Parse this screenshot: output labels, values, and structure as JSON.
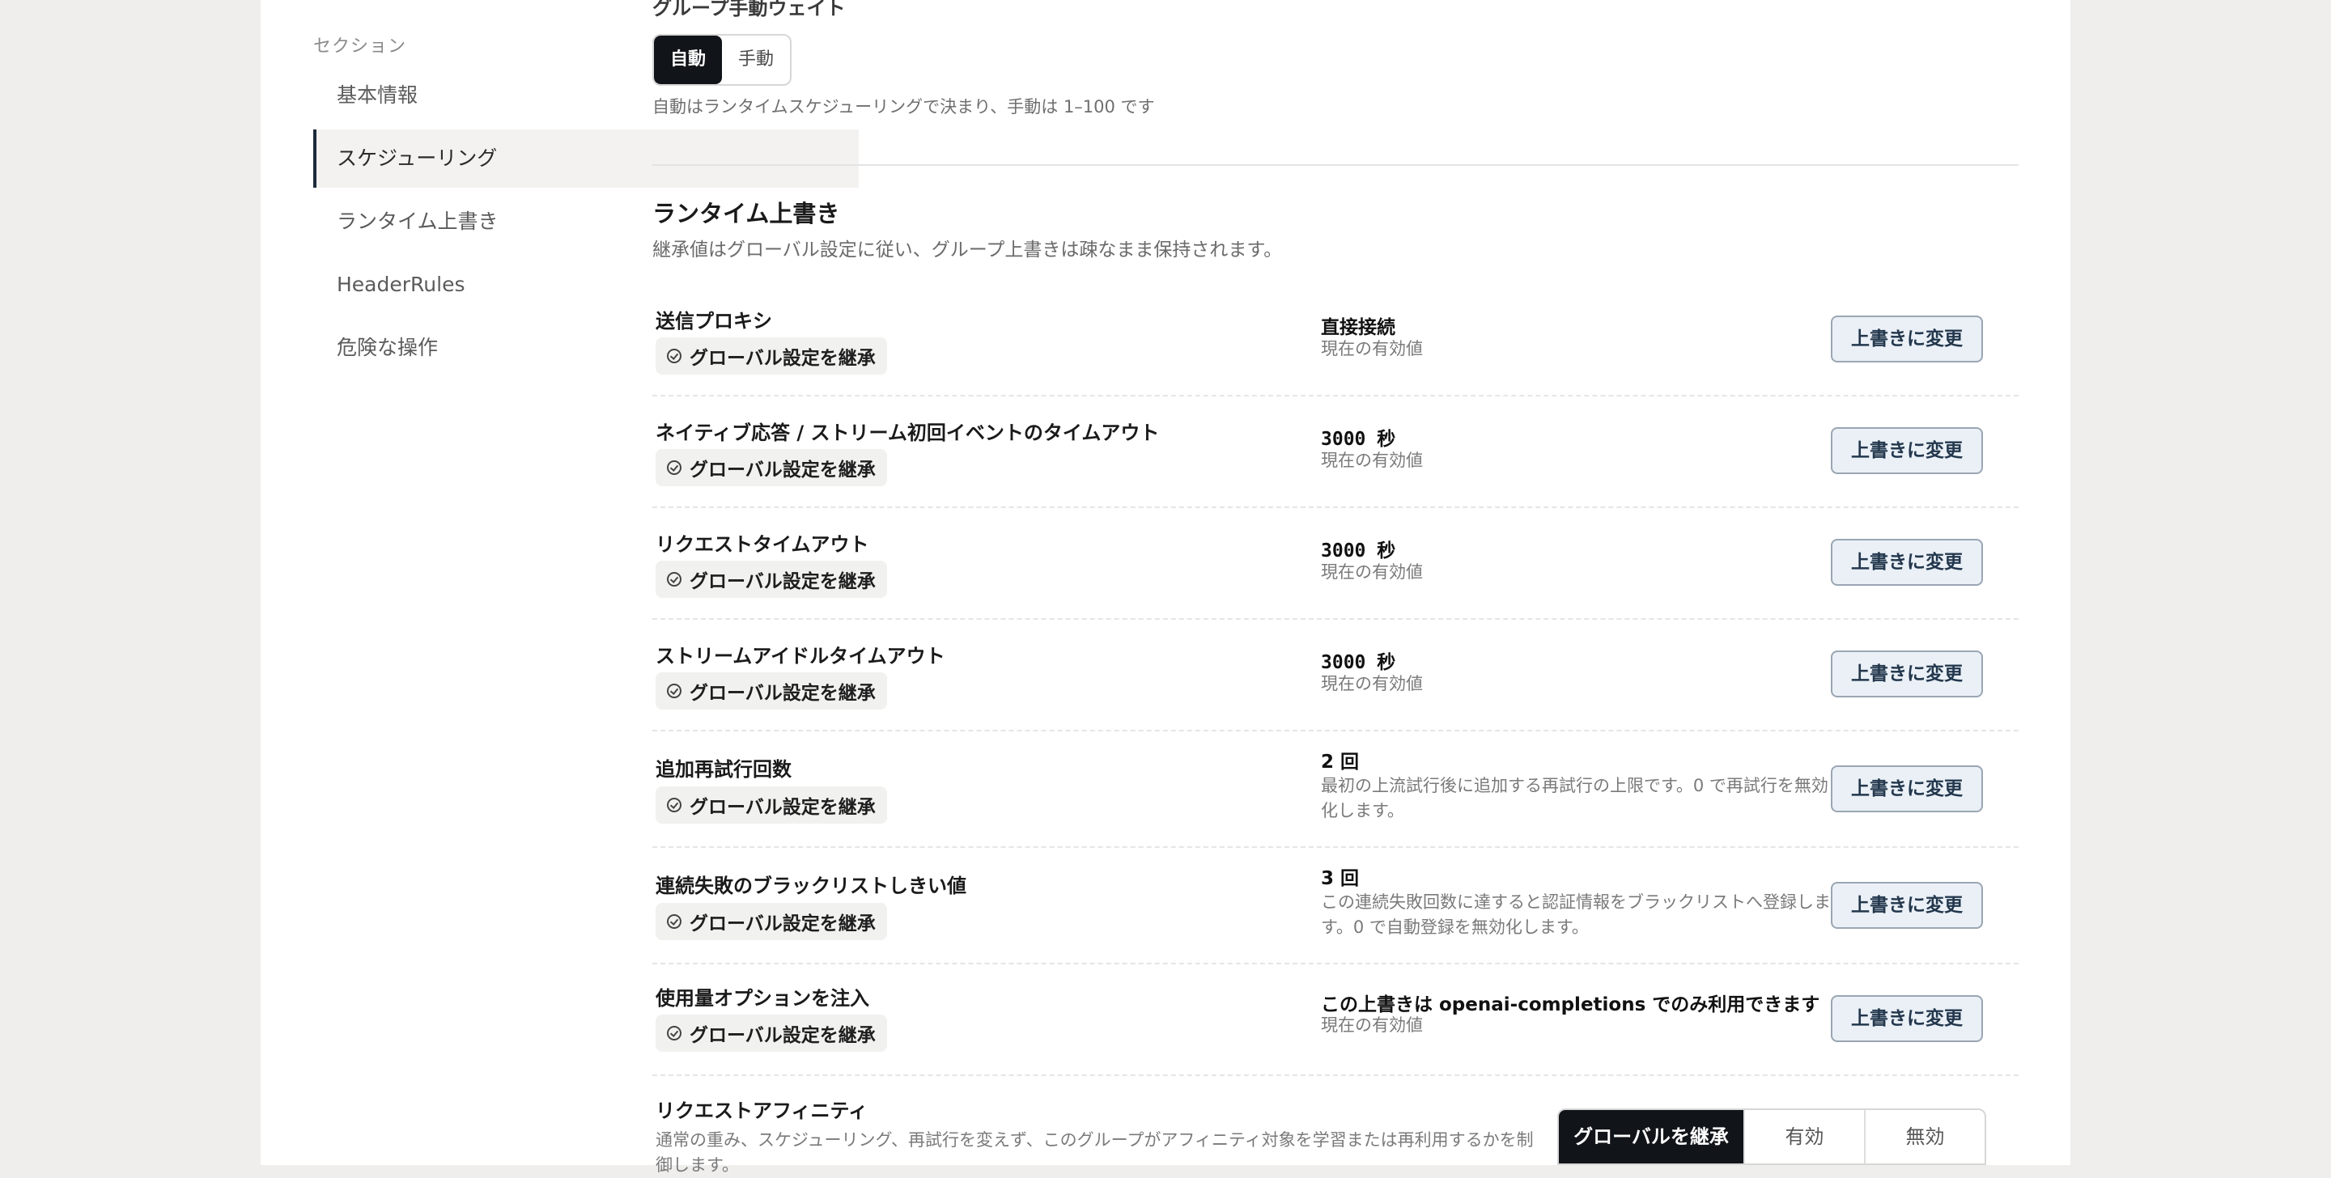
{
  "sidebar": {
    "heading": "セクション",
    "items": [
      {
        "label": "基本情報",
        "active": false
      },
      {
        "label": "スケジューリング",
        "active": true
      },
      {
        "label": "ランタイム上書き",
        "active": false
      },
      {
        "label": "HeaderRules",
        "active": false
      },
      {
        "label": "危険な操作",
        "active": false
      }
    ]
  },
  "group_weight": {
    "heading": "グループ手動ウェイト",
    "options": [
      "自動",
      "手動"
    ],
    "selected": "自動",
    "hint": "自動はランタイムスケジューリングで決まり、手動は 1–100 です"
  },
  "runtime": {
    "title": "ランタイム上書き",
    "subtitle": "継承値はグローバル設定に従い、グループ上書きは疎なまま保持されます。",
    "inherit_badge": "グローバル設定を継承",
    "override_button": "上書きに変更",
    "current_label": "現在の有効値",
    "rows": [
      {
        "label": "送信プロキシ",
        "value": "直接接続",
        "desc": "現在の有効値"
      },
      {
        "label": "ネイティブ応答 / ストリーム初回イベントのタイムアウト",
        "value": "3000 秒",
        "desc": "現在の有効値"
      },
      {
        "label": "リクエストタイムアウト",
        "value": "3000 秒",
        "desc": "現在の有効値"
      },
      {
        "label": "ストリームアイドルタイムアウト",
        "value": "3000 秒",
        "desc": "現在の有効値"
      },
      {
        "label": "追加再試行回数",
        "value": "2 回",
        "desc": "最初の上流試行後に追加する再試行の上限です。0 で再試行を無効化します。"
      },
      {
        "label": "連続失敗のブラックリストしきい値",
        "value": "3 回",
        "desc": "この連続失敗回数に達すると認証情報をブラックリストへ登録します。0 で自動登録を無効化します。"
      },
      {
        "label": "使用量オプションを注入",
        "value": "この上書きは openai-completions でのみ利用できます",
        "desc": "現在の有効値"
      }
    ],
    "affinity": {
      "label": "リクエストアフィニティ",
      "desc": "通常の重み、スケジューリング、再試行を変えず、このグループがアフィニティ対象を学習または再利用するかを制御します。",
      "options": [
        "グローバルを継承",
        "有効",
        "無効"
      ],
      "selected": "グローバルを継承"
    }
  }
}
